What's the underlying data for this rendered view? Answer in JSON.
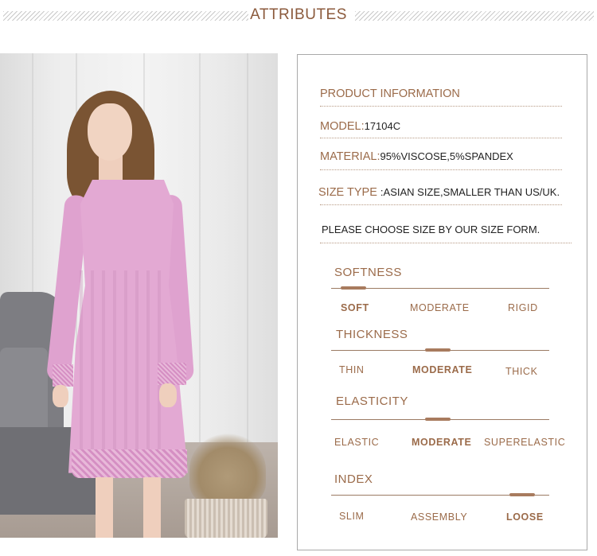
{
  "header": {
    "title": "ATTRIBUTES"
  },
  "info": {
    "product_information": "PRODUCT INFORMATION",
    "model_label": "MODEL:",
    "model_value": "17104C",
    "material_label": "MATERIAL:",
    "material_value": "95%VISCOSE,5%SPANDEX",
    "size_type_label": "SIZE TYPE",
    "size_type_value": ":ASIAN SIZE,SMALLER THAN US/UK.",
    "size_note": "PLEASE CHOOSE SIZE BY OUR SIZE FORM."
  },
  "attributes": {
    "softness": {
      "title": "SOFTNESS",
      "options": [
        "SOFT",
        "MODERATE",
        "RIGID"
      ],
      "selected_index": 0
    },
    "thickness": {
      "title": "THICKNESS",
      "options": [
        "THIN",
        "MODERATE",
        "THICK"
      ],
      "selected_index": 1
    },
    "elasticity": {
      "title": "ELASTICITY",
      "options": [
        "ELASTIC",
        "MODERATE",
        "SUPERELASTIC"
      ],
      "selected_index": 1
    },
    "index": {
      "title": "INDEX",
      "options": [
        "SLIM",
        "ASSEMBLY",
        "LOOSE"
      ],
      "selected_index": 2
    }
  },
  "colors": {
    "accent_brown": "#9b6b4a",
    "dress_pink": "#e3a9d3",
    "divider": "#b79a84"
  }
}
